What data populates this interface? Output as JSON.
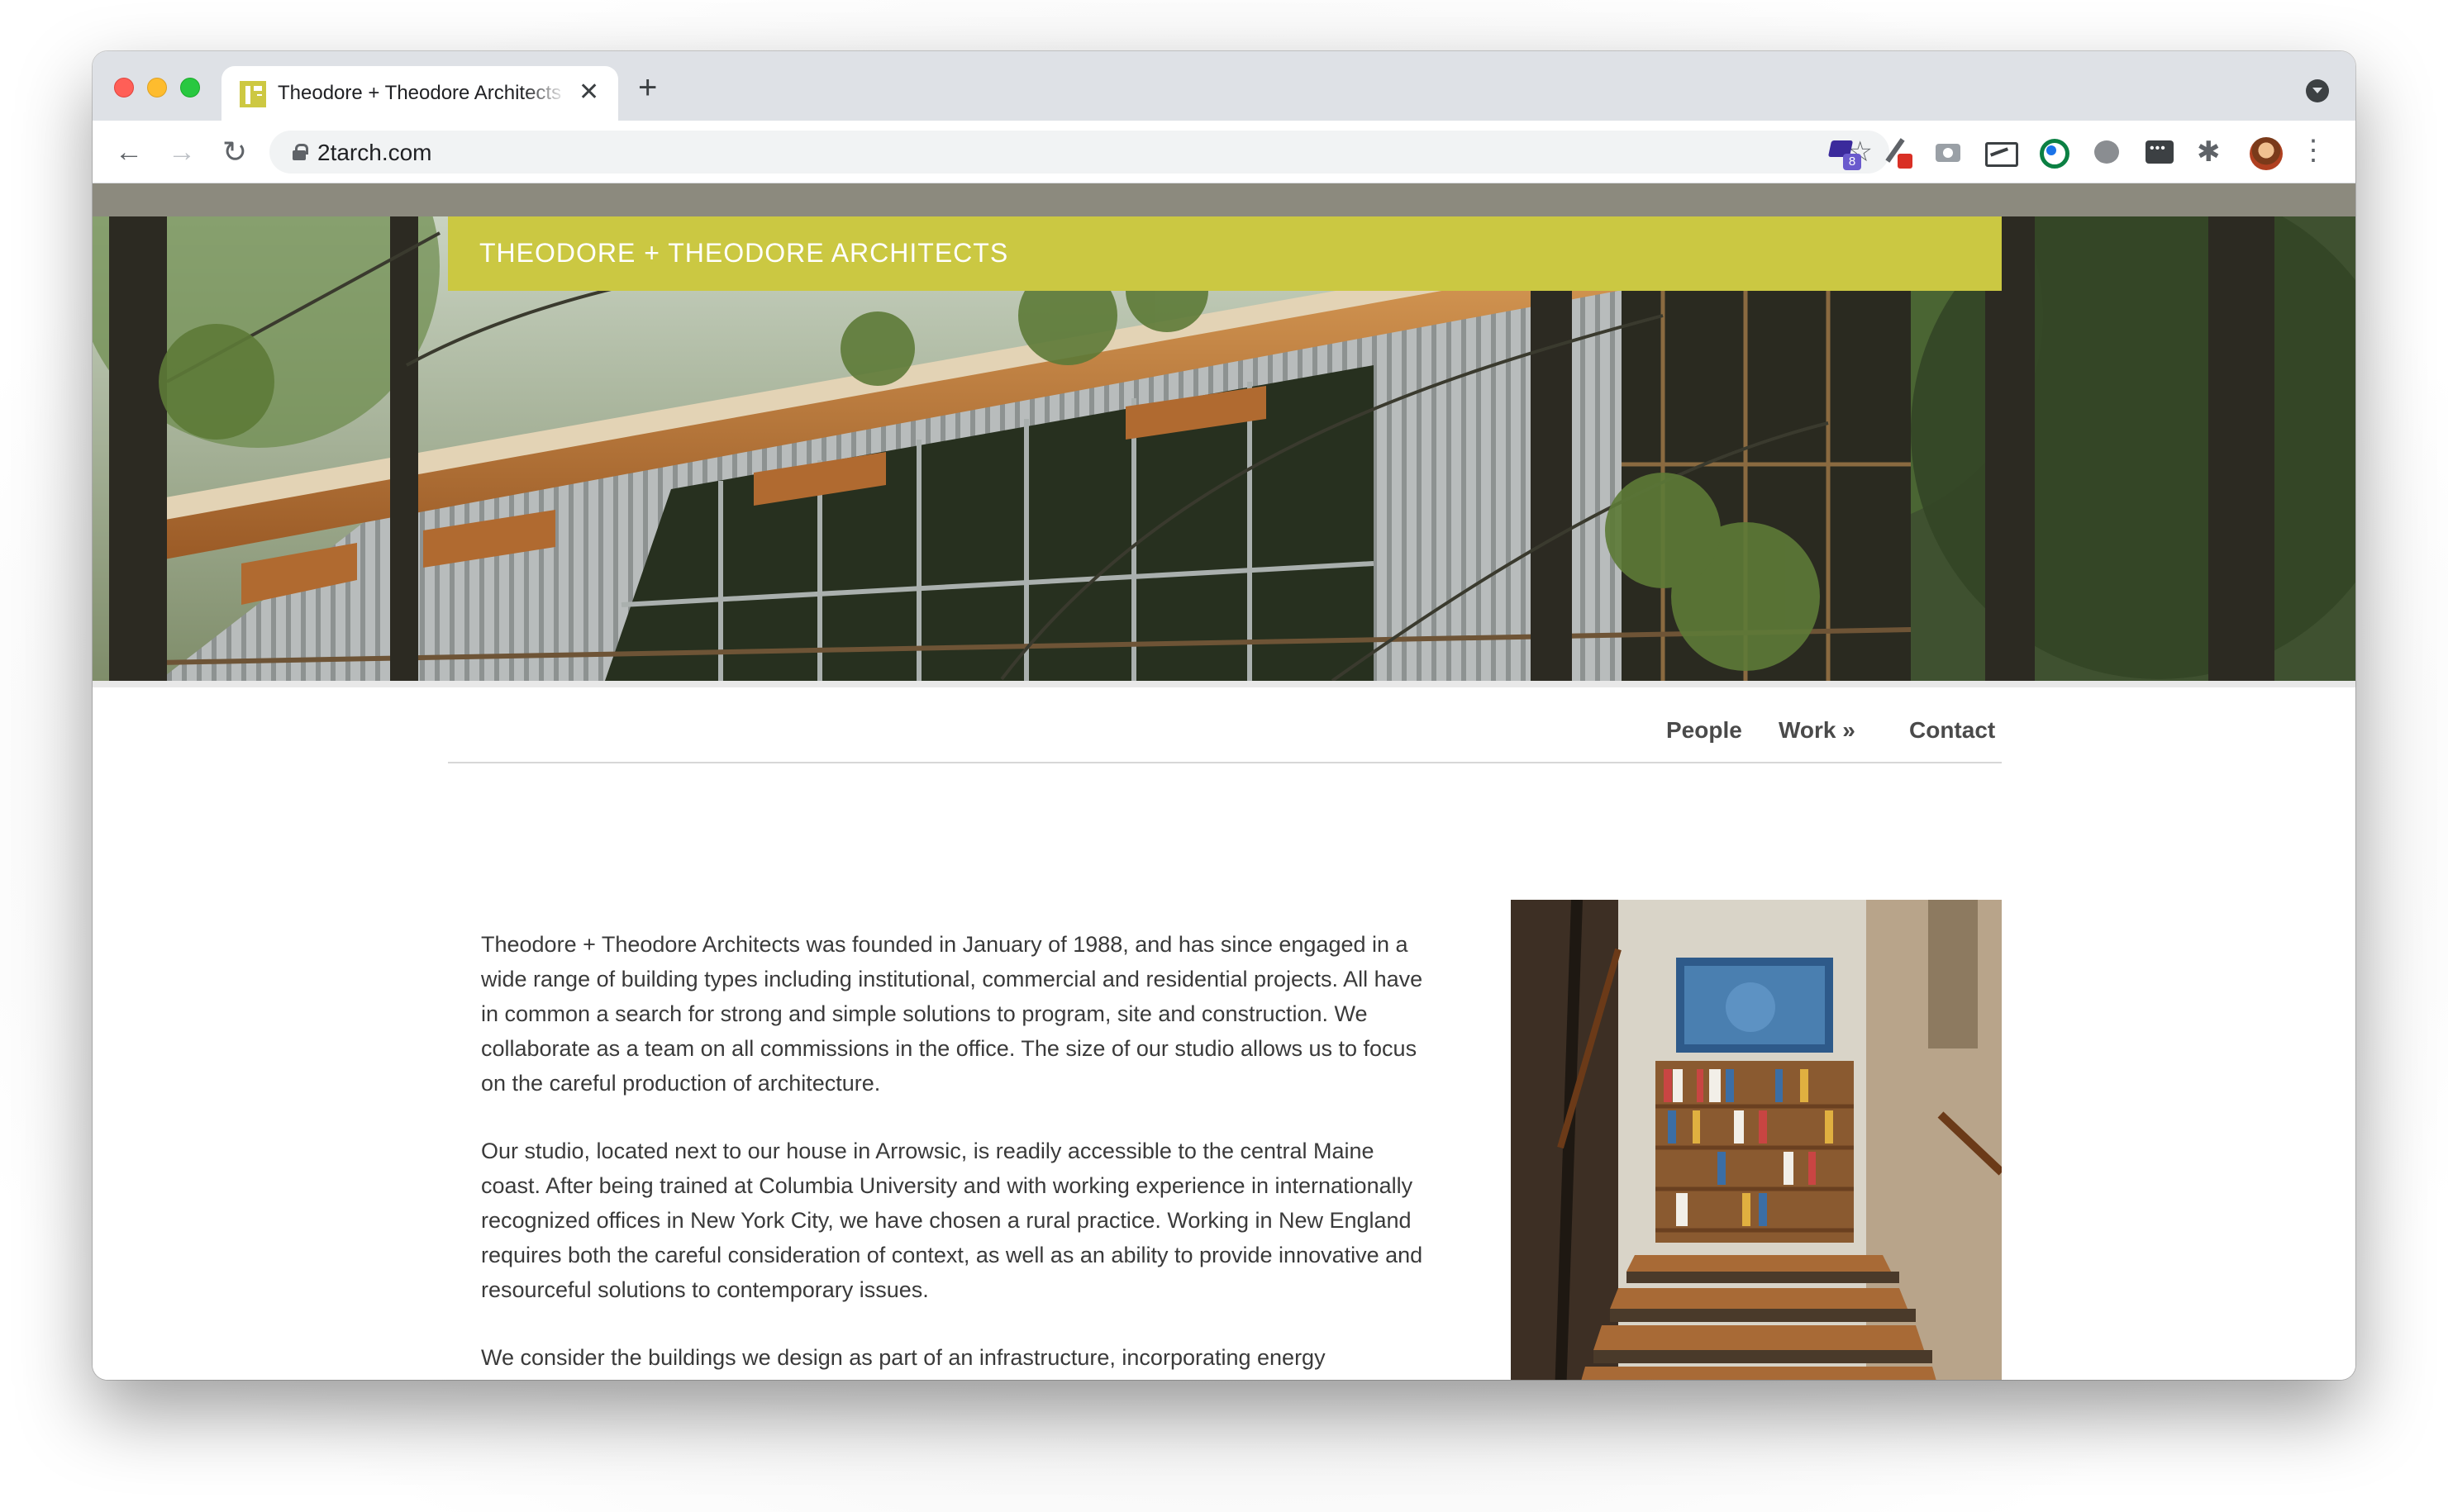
{
  "browser": {
    "tab_title": "Theodore + Theodore Architects",
    "tab_close": "✕",
    "new_tab": "+",
    "url": "2tarch.com",
    "nav_back": "←",
    "nav_forward": "→",
    "nav_reload": "↻",
    "bookmark_star": "☆",
    "extension_badge": "8",
    "extensions_puzzle": "✱",
    "menu": "⋮",
    "colors": {
      "tabstrip": "#dee1e6",
      "toolbar": "#ffffff",
      "omnibox": "#f1f3f4"
    }
  },
  "site": {
    "title": "THEODORE + THEODORE ARCHITECTS",
    "colors": {
      "title_bar": "#cbc842",
      "top_bar": "#8c8a7e",
      "text": "#3a3a3a",
      "nav_text": "#4a4a4a"
    },
    "hero_image": "house-among-pine-trees",
    "side_image": "interior-staircase-with-bookshelf",
    "nav": {
      "people": "People",
      "work": "Work »",
      "contact": "Contact"
    },
    "paragraphs": [
      "Theodore + Theodore Architects was founded in January of 1988, and has since engaged in a wide range of building types including institutional, commercial and residential projects. All have in common a search for strong and simple solutions to program, site and construction. We collaborate as a team on all commissions in the office. The size of our studio allows us to focus on the careful production of architecture.",
      "Our studio, located next to our house in Arrowsic, is readily accessible to the central Maine coast. After being trained at Columbia University and with working experience in internationally recognized offices in New York City, we have chosen a rural practice. Working in New England requires both the careful consideration of context, as well as an ability to provide innovative and resourceful solutions to contemporary issues.",
      "We consider the buildings we design as part of an infrastructure, incorporating energy efficiency and sound construction techniques which are adaptable for multiple uses, like the row houses, mills, factories, barns and farmhouses found along the Eastern seaboard."
    ]
  }
}
